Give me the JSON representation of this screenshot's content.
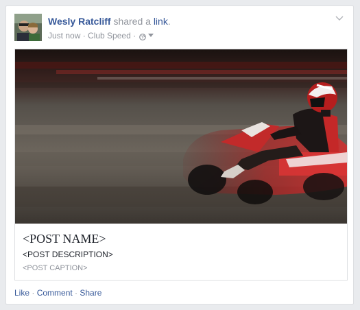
{
  "post": {
    "actor_name": "Wesly Ratcliff",
    "action_text": "shared a",
    "action_link": "link",
    "action_period": ".",
    "timestamp": "Just now",
    "separator": " · ",
    "source": "Club Speed",
    "privacy_icon": "globe-icon",
    "menu_icon": "chevron-down-icon"
  },
  "attachment": {
    "image_subject": "go-kart racer",
    "name": "<POST NAME>",
    "description": "<POST DESCRIPTION>",
    "caption": "<POST CAPTION>"
  },
  "actions": {
    "like": "Like",
    "comment": "Comment",
    "share": "Share",
    "separator": " · "
  },
  "colors": {
    "link_blue": "#365899",
    "meta_gray": "#90949c",
    "text_dark": "#1d2129",
    "border": "#dddfe2",
    "page_bg": "#e9ebee"
  }
}
